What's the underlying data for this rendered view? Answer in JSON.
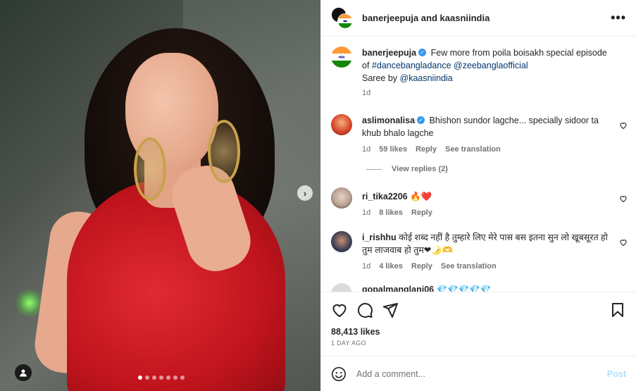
{
  "header": {
    "title": "banerjeepuja and kaasniindia",
    "more_icon": "more-horizontal-icon"
  },
  "caption": {
    "username": "banerjeepuja",
    "text_before": "Few more from poila boisakh special episode of",
    "hashtag": "#dancebangladance",
    "mention": "@zeebanglaofficial",
    "line2_prefix": "Saree by",
    "line2_mention": "@kaasniindia",
    "time": "1d"
  },
  "comments": [
    {
      "username": "aslimonalisa",
      "verified": true,
      "text": "Bhishon sundor lagche... specially sidoor ta khub bhalo lagche",
      "time": "1d",
      "likes": "59 likes",
      "reply": "Reply",
      "translation": "See translation",
      "view_replies": "View replies (2)"
    },
    {
      "username": "ri_tika2206",
      "text": "🔥❤️",
      "time": "1d",
      "likes": "8 likes",
      "reply": "Reply"
    },
    {
      "username": "i_rishhu",
      "text": "कोई शब्द नहीं है तुम्हारे लिए मेरे पास बस इतना सुन लो खूबसूरत हो तुम लाजवाब हो तुम❤🌛🫶",
      "time": "1d",
      "likes": "4 likes",
      "reply": "Reply",
      "translation": "See translation"
    },
    {
      "username": "gopalmanglani06",
      "text": "💎💎💎💎💎"
    }
  ],
  "actions": {
    "likes": "88,413 likes",
    "date": "1 DAY AGO"
  },
  "add_comment": {
    "placeholder": "Add a comment...",
    "post_label": "Post"
  },
  "carousel": {
    "dot_count": 7,
    "active_index": 0
  },
  "colors": {
    "link": "#00376b",
    "verified": "#3897f0",
    "post_disabled": "#b2dffc",
    "muted": "#737373"
  }
}
